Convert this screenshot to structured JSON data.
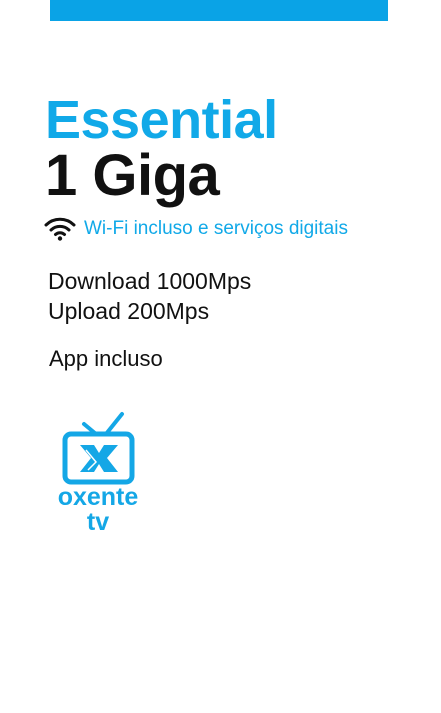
{
  "colors": {
    "accent": "#11a9e8",
    "bar": "#0aa3e6",
    "text": "#111111"
  },
  "plan": {
    "name": "Essential",
    "speed": "1 Giga",
    "feature_icon": "wifi-icon",
    "feature_text": "Wi-Fi incluso e serviços digitais",
    "download": "Download 1000Mps",
    "upload": "Upload 200Mps",
    "app_label": "App incluso"
  },
  "app_logo": {
    "icon": "tv-icon",
    "brand_line1": "oxente",
    "brand_line2": "tv"
  }
}
